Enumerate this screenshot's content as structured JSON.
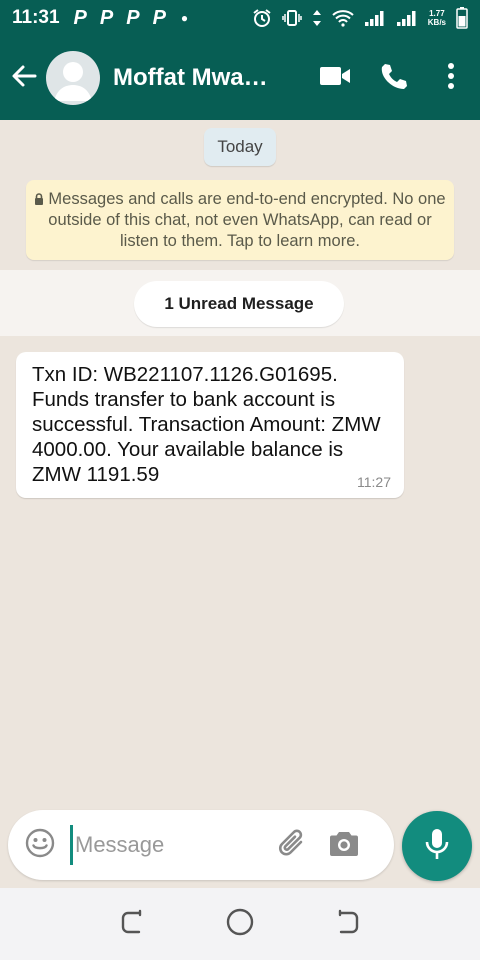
{
  "status_bar": {
    "time": "11:31",
    "notification_glyph": "P",
    "net_speed_value": "1.77",
    "net_speed_unit": "KB/s",
    "icons": [
      "alarm-icon",
      "vibrate-icon",
      "data-arrows-icon",
      "wifi-icon",
      "signal-1-icon",
      "signal-2-icon",
      "battery-icon"
    ]
  },
  "app_bar": {
    "contact_name": "Moffat Mwa…",
    "background_color": "#075e54",
    "icons": [
      "back-arrow-icon",
      "avatar-placeholder-icon",
      "video-call-icon",
      "voice-call-icon",
      "more-options-icon"
    ]
  },
  "chat": {
    "date_label": "Today",
    "encryption_notice": "Messages and calls are end-to-end encrypted. No one outside of this chat, not even WhatsApp, can read or listen to them. Tap to learn more.",
    "unread_label": "1 Unread Message",
    "messages": [
      {
        "text": "Txn ID: WB221107.1126.G01695. Funds transfer to bank account is successful. Transaction Amount: ZMW 4000.00. Your available balance is ZMW 1191.59",
        "time": "11:27",
        "direction": "incoming"
      }
    ]
  },
  "composer": {
    "placeholder": "Message",
    "accent_color": "#128c7e",
    "icons": [
      "emoji-icon",
      "attach-icon",
      "camera-icon",
      "mic-icon"
    ]
  },
  "nav_bar": {
    "icons": [
      "recents-icon",
      "home-icon",
      "back-icon"
    ]
  }
}
